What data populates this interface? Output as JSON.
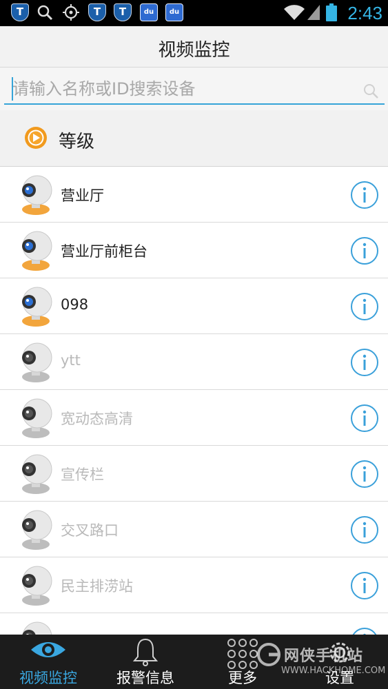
{
  "status_bar": {
    "time": "2:43",
    "left_icons": [
      "shield-t-icon",
      "search-icon",
      "gps-icon",
      "shield-t-icon",
      "shield-t-icon",
      "baidu-icon",
      "baidu-icon"
    ],
    "right_icons": [
      "wifi-icon",
      "signal-icon",
      "battery-icon"
    ]
  },
  "header": {
    "title": "视频监控"
  },
  "search": {
    "placeholder": "请输入名称或ID搜索设备",
    "value": ""
  },
  "group": {
    "label": "等级"
  },
  "devices": [
    {
      "name": "营业厅",
      "online": true
    },
    {
      "name": "营业厅前柜台",
      "online": true
    },
    {
      "name": "098",
      "online": true
    },
    {
      "name": "ytt",
      "online": false
    },
    {
      "name": "宽动态高清",
      "online": false
    },
    {
      "name": "宣传栏",
      "online": false
    },
    {
      "name": "交叉路口",
      "online": false
    },
    {
      "name": "民主排涝站",
      "online": false
    },
    {
      "name": "",
      "online": false
    }
  ],
  "bottom_nav": {
    "items": [
      {
        "label": "视频监控",
        "icon": "eye-icon",
        "active": true
      },
      {
        "label": "报警信息",
        "icon": "bell-icon",
        "active": false
      },
      {
        "label": "更多",
        "icon": "grid-dots-icon",
        "active": false
      },
      {
        "label": "设置",
        "icon": "gear-icon",
        "active": false
      }
    ]
  },
  "watermark": {
    "text": "网侠手机站",
    "url": "WWW.HACKHOME.COM"
  },
  "colors": {
    "accent": "#35a4d8",
    "status_time": "#35b5e5",
    "nav_bg": "#1c1c1c",
    "offline_text": "#b9b9b9"
  }
}
